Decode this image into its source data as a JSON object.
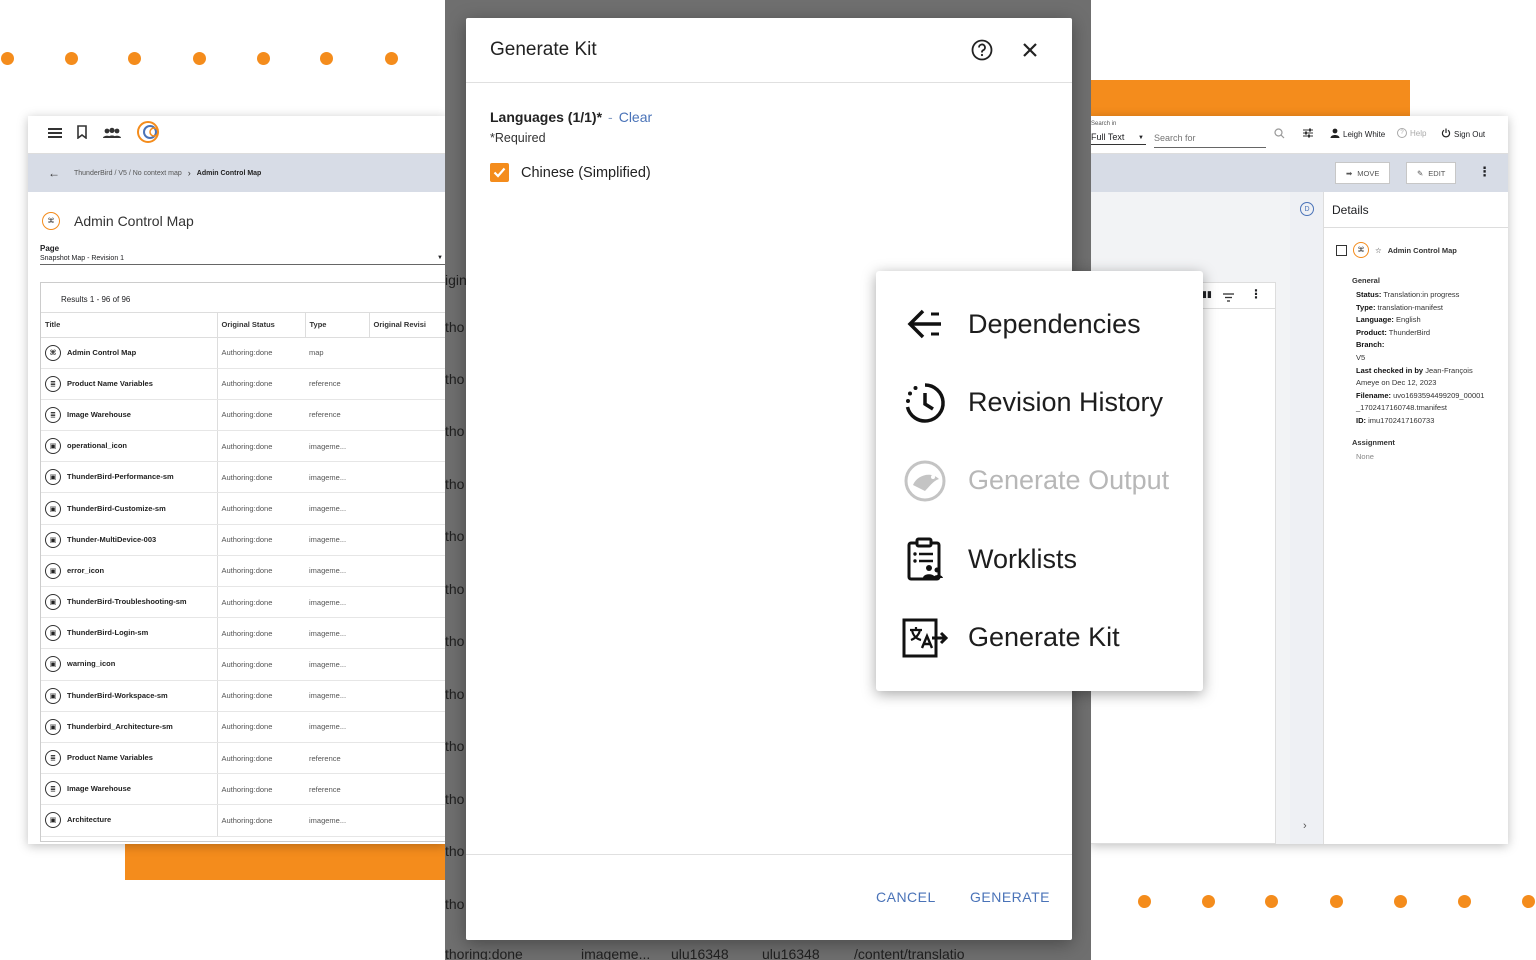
{
  "colors": {
    "accent": "#f48c1c",
    "link": "#4a73b8",
    "backdrop": "#6f6f6f"
  },
  "left_window": {
    "breadcrumb": {
      "path": "ThunderBird / V5 / No context map",
      "current": "Admin Control Map"
    },
    "map_title": "Admin Control Map",
    "page_label": "Page",
    "page_select_value": "Snapshot Map - Revision 1",
    "results_count": "Results 1 - 96 of 96",
    "table": {
      "headers": [
        "Title",
        "Original Status",
        "Type",
        "Original Revisi"
      ],
      "rows": [
        {
          "title": "Admin Control Map",
          "status": "Authoring:done",
          "type": "map",
          "icon": "map-icon"
        },
        {
          "title": "Product Name Variables",
          "status": "Authoring:done",
          "type": "reference",
          "icon": "reference-icon"
        },
        {
          "title": "Image Warehouse",
          "status": "Authoring:done",
          "type": "reference",
          "icon": "reference-icon"
        },
        {
          "title": "operational_icon",
          "status": "Authoring:done",
          "type": "imageme...",
          "icon": "image-icon"
        },
        {
          "title": "ThunderBird-Performance-sm",
          "status": "Authoring:done",
          "type": "imageme...",
          "icon": "image-icon"
        },
        {
          "title": "ThunderBird-Customize-sm",
          "status": "Authoring:done",
          "type": "imageme...",
          "icon": "image-icon"
        },
        {
          "title": "Thunder-MultiDevice-003",
          "status": "Authoring:done",
          "type": "imageme...",
          "icon": "image-icon"
        },
        {
          "title": "error_icon",
          "status": "Authoring:done",
          "type": "imageme...",
          "icon": "image-icon"
        },
        {
          "title": "ThunderBird-Troubleshooting-sm",
          "status": "Authoring:done",
          "type": "imageme...",
          "icon": "image-icon"
        },
        {
          "title": "ThunderBird-Login-sm",
          "status": "Authoring:done",
          "type": "imageme...",
          "icon": "image-icon"
        },
        {
          "title": "warning_icon",
          "status": "Authoring:done",
          "type": "imageme...",
          "icon": "image-icon"
        },
        {
          "title": "ThunderBird-Workspace-sm",
          "status": "Authoring:done",
          "type": "imageme...",
          "icon": "image-icon"
        },
        {
          "title": "Thunderbird_Architecture-sm",
          "status": "Authoring:done",
          "type": "imageme...",
          "icon": "image-icon"
        },
        {
          "title": "Product Name Variables",
          "status": "Authoring:done",
          "type": "reference",
          "icon": "reference-icon"
        },
        {
          "title": "Image Warehouse",
          "status": "Authoring:done",
          "type": "reference",
          "icon": "reference-icon"
        },
        {
          "title": "Architecture",
          "status": "Authoring:done",
          "type": "imageme...",
          "icon": "image-icon"
        }
      ]
    }
  },
  "right_window": {
    "search_in_label": "Search in",
    "search_in_value": "Full Text",
    "search_placeholder": "Search for",
    "user_name": "Leigh White",
    "help_label": "Help",
    "sign_out_label": "Sign Out",
    "move_label": "MOVE",
    "edit_label": "EDIT",
    "details_title": "Details",
    "rail_badge": "D",
    "item_name": "Admin Control Map",
    "general_heading": "General",
    "fields": [
      {
        "key": "Status:",
        "value": "Translation:in progress"
      },
      {
        "key": "Type:",
        "value": "translation-manifest"
      },
      {
        "key": "Language:",
        "value": "English"
      },
      {
        "key": "Product:",
        "value": "ThunderBird"
      },
      {
        "key": "Branch:",
        "value": ""
      },
      {
        "key": "",
        "value": "V5"
      },
      {
        "key": "Last checked in by",
        "value": "Jean-François"
      },
      {
        "key": "",
        "value": "Ameye on Dec 12, 2023"
      },
      {
        "key": "Filename:",
        "value": "uvo1693594499209_00001"
      },
      {
        "key": "",
        "value": "_1702417160748.tmanifest"
      },
      {
        "key": "ID:",
        "value": "imu1702417160733"
      }
    ],
    "assignment_heading": "Assignment",
    "assignment_value": "None"
  },
  "backdrop_texts": [
    "igin",
    "tho",
    "thoring:done",
    "imageme...",
    "ulu16348",
    "ulu16348",
    "/content/translatio"
  ],
  "modal": {
    "title": "Generate Kit",
    "languages_label": "Languages (1/1)*",
    "separator": "-",
    "clear_label": "Clear",
    "required_note": "*Required",
    "language_option": "Chinese (Simplified)",
    "language_checked": true,
    "cancel_label": "CANCEL",
    "generate_label": "GENERATE"
  },
  "context_menu": {
    "items": [
      {
        "label": "Dependencies",
        "icon": "arrow-left-icon",
        "disabled": false
      },
      {
        "label": "Revision History",
        "icon": "history-icon",
        "disabled": false
      },
      {
        "label": "Generate Output",
        "icon": "generate-output-icon",
        "disabled": true
      },
      {
        "label": "Worklists",
        "icon": "worklists-icon",
        "disabled": false
      },
      {
        "label": "Generate Kit",
        "icon": "translate-icon",
        "disabled": false
      }
    ]
  }
}
